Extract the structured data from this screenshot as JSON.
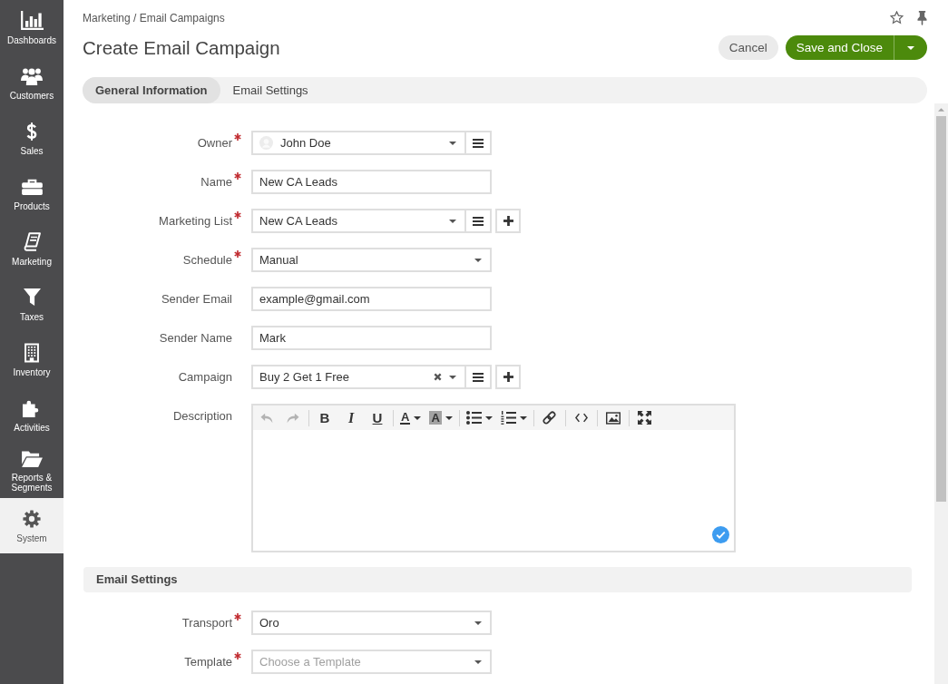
{
  "sidebar": {
    "items": [
      {
        "label": "Dashboards",
        "selected": false
      },
      {
        "label": "Customers",
        "selected": false
      },
      {
        "label": "Sales",
        "selected": false
      },
      {
        "label": "Products",
        "selected": false
      },
      {
        "label": "Marketing",
        "selected": false
      },
      {
        "label": "Taxes",
        "selected": false
      },
      {
        "label": "Inventory",
        "selected": false
      },
      {
        "label": "Activities",
        "selected": false
      },
      {
        "label": "Reports & Segments",
        "selected": false
      },
      {
        "label": "System",
        "selected": true
      }
    ]
  },
  "header": {
    "breadcrumb": "Marketing / Email Campaigns",
    "title": "Create Email Campaign",
    "buttons": {
      "cancel": "Cancel",
      "save": "Save and Close"
    }
  },
  "tabs": [
    {
      "label": "General Information",
      "selected": true
    },
    {
      "label": "Email Settings",
      "selected": false
    }
  ],
  "general": {
    "fields": [
      {
        "label": "Owner",
        "required": true,
        "kind": "select",
        "value": "John Doe",
        "avatar": true,
        "list_button": true
      },
      {
        "label": "Name",
        "required": true,
        "kind": "text",
        "value": "New CA Leads"
      },
      {
        "label": "Marketing List",
        "required": true,
        "kind": "select",
        "value": "New CA Leads",
        "list_button": true,
        "add_button": true
      },
      {
        "label": "Schedule",
        "required": true,
        "kind": "select",
        "value": "Manual"
      },
      {
        "label": "Sender Email",
        "required": false,
        "kind": "text",
        "value": "example@gmail.com"
      },
      {
        "label": "Sender Name",
        "required": false,
        "kind": "text",
        "value": "Mark"
      },
      {
        "label": "Campaign",
        "required": false,
        "kind": "select",
        "value": "Buy 2 Get 1 Free",
        "clearable": true,
        "list_button": true,
        "add_button": true
      },
      {
        "label": "Description",
        "required": false,
        "kind": "editor",
        "toolbar": {
          "undo": {
            "disabled": true
          },
          "redo": {
            "disabled": true
          },
          "bold": "B",
          "italic": "I",
          "underline": "U",
          "text_color": "A",
          "background_color": "A"
        }
      }
    ]
  },
  "email_settings": {
    "title": "Email Settings",
    "fields": [
      {
        "label": "Transport",
        "required": true,
        "kind": "select",
        "value": "Oro"
      },
      {
        "label": "Template",
        "required": true,
        "kind": "select",
        "placeholder": "Choose a Template"
      }
    ]
  }
}
